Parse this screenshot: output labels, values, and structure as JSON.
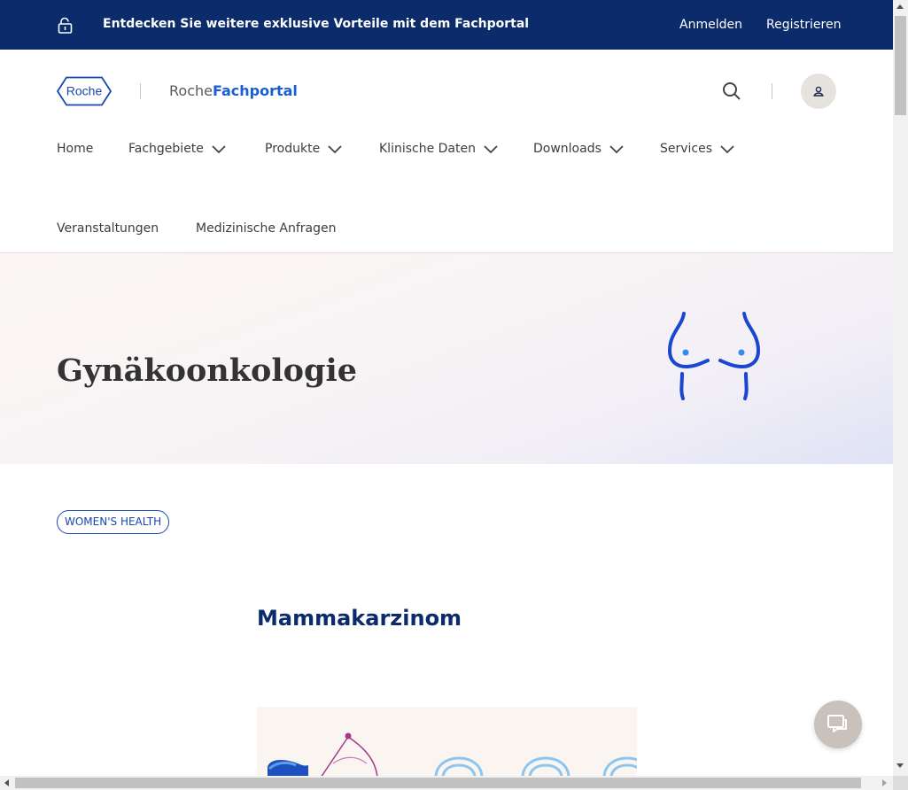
{
  "promo": {
    "text": "Entdecken Sie weitere exklusive Vorteile mit dem Fachportal",
    "login": "Anmelden",
    "register": "Registrieren"
  },
  "header": {
    "logo_text": "Roche",
    "portal_prefix": "Roche",
    "portal_name": "Fachportal"
  },
  "nav": {
    "items": [
      {
        "label": "Home"
      },
      {
        "label": "Fachgebiete"
      },
      {
        "label": "Produkte"
      },
      {
        "label": "Klinische Daten"
      },
      {
        "label": "Downloads"
      },
      {
        "label": "Services"
      },
      {
        "label": "Veranstaltungen"
      },
      {
        "label": "Medizinische Anfragen"
      }
    ]
  },
  "hero": {
    "title": "Gynäkoonkologie"
  },
  "tag": {
    "label": "WOMEN'S HEALTH"
  },
  "section": {
    "title": "Mammakarzinom"
  },
  "colors": {
    "brand_dark": "#0b2b6b",
    "brand_blue": "#1b5ed2"
  }
}
